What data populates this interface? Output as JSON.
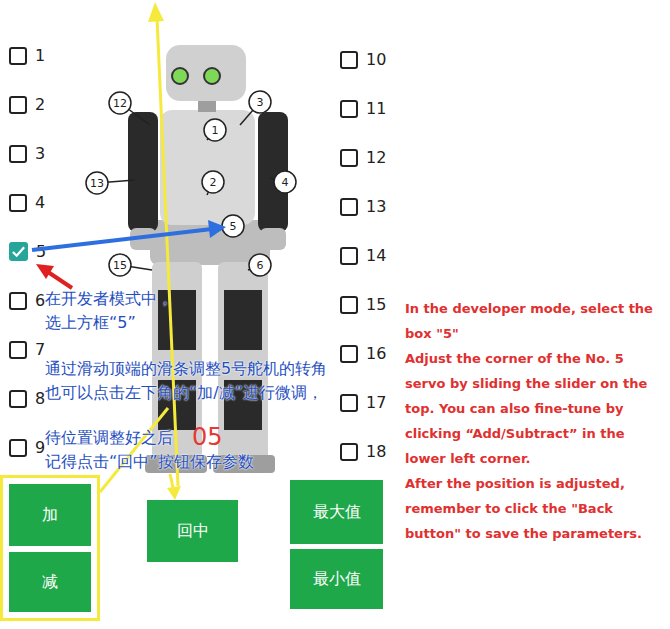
{
  "checkboxes_left": [
    {
      "label": "1",
      "checked": false
    },
    {
      "label": "2",
      "checked": false
    },
    {
      "label": "3",
      "checked": false
    },
    {
      "label": "4",
      "checked": false
    },
    {
      "label": "5",
      "checked": true
    },
    {
      "label": "6",
      "checked": false
    },
    {
      "label": "7",
      "checked": false
    },
    {
      "label": "8",
      "checked": false
    },
    {
      "label": "9",
      "checked": false
    }
  ],
  "checkboxes_right": [
    {
      "label": "10",
      "checked": false
    },
    {
      "label": "11",
      "checked": false
    },
    {
      "label": "12",
      "checked": false
    },
    {
      "label": "13",
      "checked": false
    },
    {
      "label": "14",
      "checked": false
    },
    {
      "label": "15",
      "checked": false
    },
    {
      "label": "16",
      "checked": false
    },
    {
      "label": "17",
      "checked": false
    },
    {
      "label": "18",
      "checked": false
    }
  ],
  "robot": {
    "callouts": [
      "12",
      "3",
      "1",
      "2",
      "13",
      "4",
      "5",
      "15",
      "6"
    ]
  },
  "angle_value": "05",
  "annotations": [
    {
      "lines": [
        "在开发者模式中，",
        "选上方框“5”"
      ]
    },
    {
      "lines": [
        "通过滑动顶端的滑条调整5号舵机的转角",
        "也可以点击左下角的“加/减”进行微调，"
      ]
    },
    {
      "lines": [
        "待位置调整好之后",
        "记得点击“回中”按钮保存参数"
      ]
    }
  ],
  "fine_tune_buttons": {
    "highlighted": true,
    "labels": [
      "加",
      "减"
    ]
  },
  "center_button": "回中",
  "limit_buttons": [
    "最大值",
    "最小值"
  ],
  "instructions": [
    "In the developer mode, select the box \"5\"",
    "Adjust the corner of the No. 5 servo by sliding the slider on the top. You can also fine-tune by clicking “Add/Subtract” in the lower left corner.",
    "After the position is adjusted, remember to click the \"Back button\" to save the parameters."
  ]
}
